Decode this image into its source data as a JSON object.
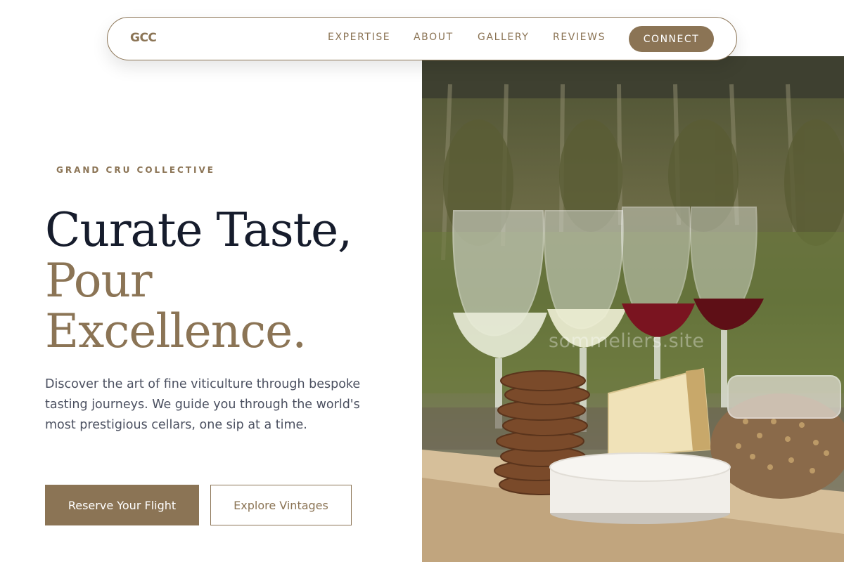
{
  "nav": {
    "brand": "GCC",
    "links": [
      "EXPERTISE",
      "ABOUT",
      "GALLERY",
      "REVIEWS"
    ],
    "cta": "CONNECT"
  },
  "hero": {
    "eyebrow": "GRAND CRU COLLECTIVE",
    "headline_line1": "Curate Taste,",
    "headline_line2": "Pour",
    "headline_line3": "Excellence.",
    "lead": "Discover the art of fine viticulture through bespoke tasting journeys. We guide you through the world's most prestigious cellars, one sip at a time.",
    "primary_cta": "Reserve Your Flight",
    "secondary_cta": "Explore Vintages",
    "image_watermark": "sommeliers.site"
  },
  "colors": {
    "accent": "#8b7455",
    "heading_dark": "#161c2c",
    "body_text": "#4b5060"
  }
}
